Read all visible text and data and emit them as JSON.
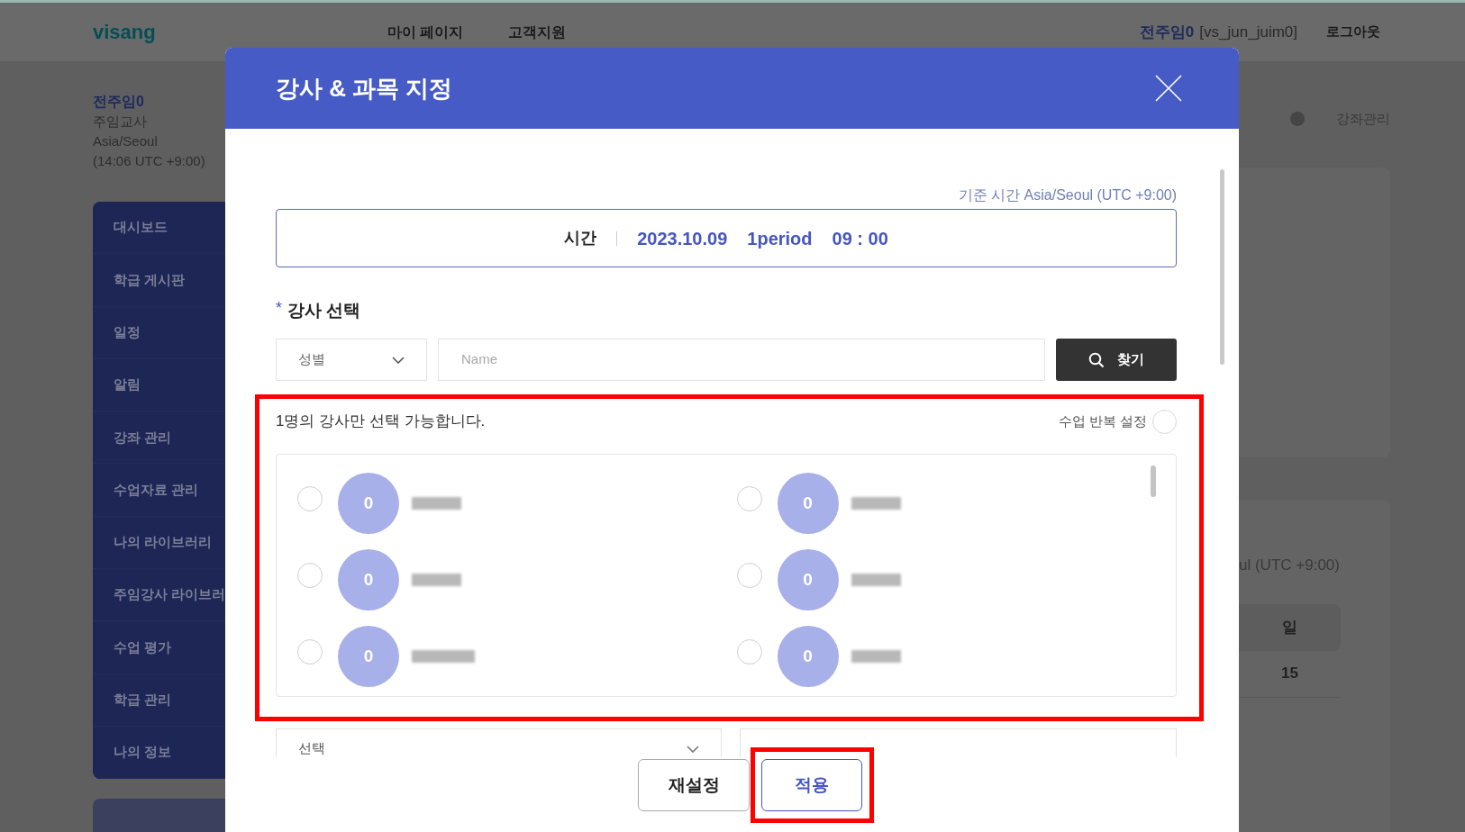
{
  "header": {
    "logo": "visang",
    "nav": [
      "마이 페이지",
      "고객지원"
    ],
    "user_name": "전주임0",
    "user_id": "[vs_jun_juim0]",
    "logout": "로그아웃"
  },
  "profile": {
    "name": "전주임0",
    "role": "주임교사",
    "timezone": "Asia/Seoul",
    "local_time": "(14:06 UTC +9:00)"
  },
  "sidebar": {
    "items": [
      "대시보드",
      "학급 게시판",
      "일정",
      "알림",
      "강좌 관리",
      "수업자료 관리",
      "나의 라이브러리",
      "주임강사 라이브러",
      "수업 평가",
      "학급 관리",
      "나의 정보"
    ]
  },
  "breadcrumb": "강좌관리",
  "background_card": {
    "timezone_fragment": "ul (UTC +9:00)",
    "column": "일",
    "cell": "15"
  },
  "dialog": {
    "title": "강사 & 과목 지정",
    "reference_time": "기준 시간 Asia/Seoul (UTC +9:00)",
    "time_label": "시간",
    "date": "2023.10.09",
    "period": "1period",
    "time": "09 : 00",
    "teacher_section": {
      "required_mark": "*",
      "label": "강사 선택"
    },
    "gender_select": "성별",
    "name_placeholder": "Name",
    "search_button": "찾기",
    "notice": "1명의 강사만 선택 가능합니다.",
    "repeat": {
      "label": "수업 반복 설정",
      "on": false
    },
    "teachers": [
      {
        "avatar": "0",
        "selected": false
      },
      {
        "avatar": "0",
        "selected": false
      },
      {
        "avatar": "0",
        "selected": false
      },
      {
        "avatar": "0",
        "selected": false
      },
      {
        "avatar": "0",
        "selected": false
      },
      {
        "avatar": "0",
        "selected": false
      }
    ],
    "subject_select": "선택",
    "buttons": [
      {
        "label": "재설정",
        "kind": "secondary"
      },
      {
        "label": "적용",
        "kind": "primary"
      }
    ]
  }
}
